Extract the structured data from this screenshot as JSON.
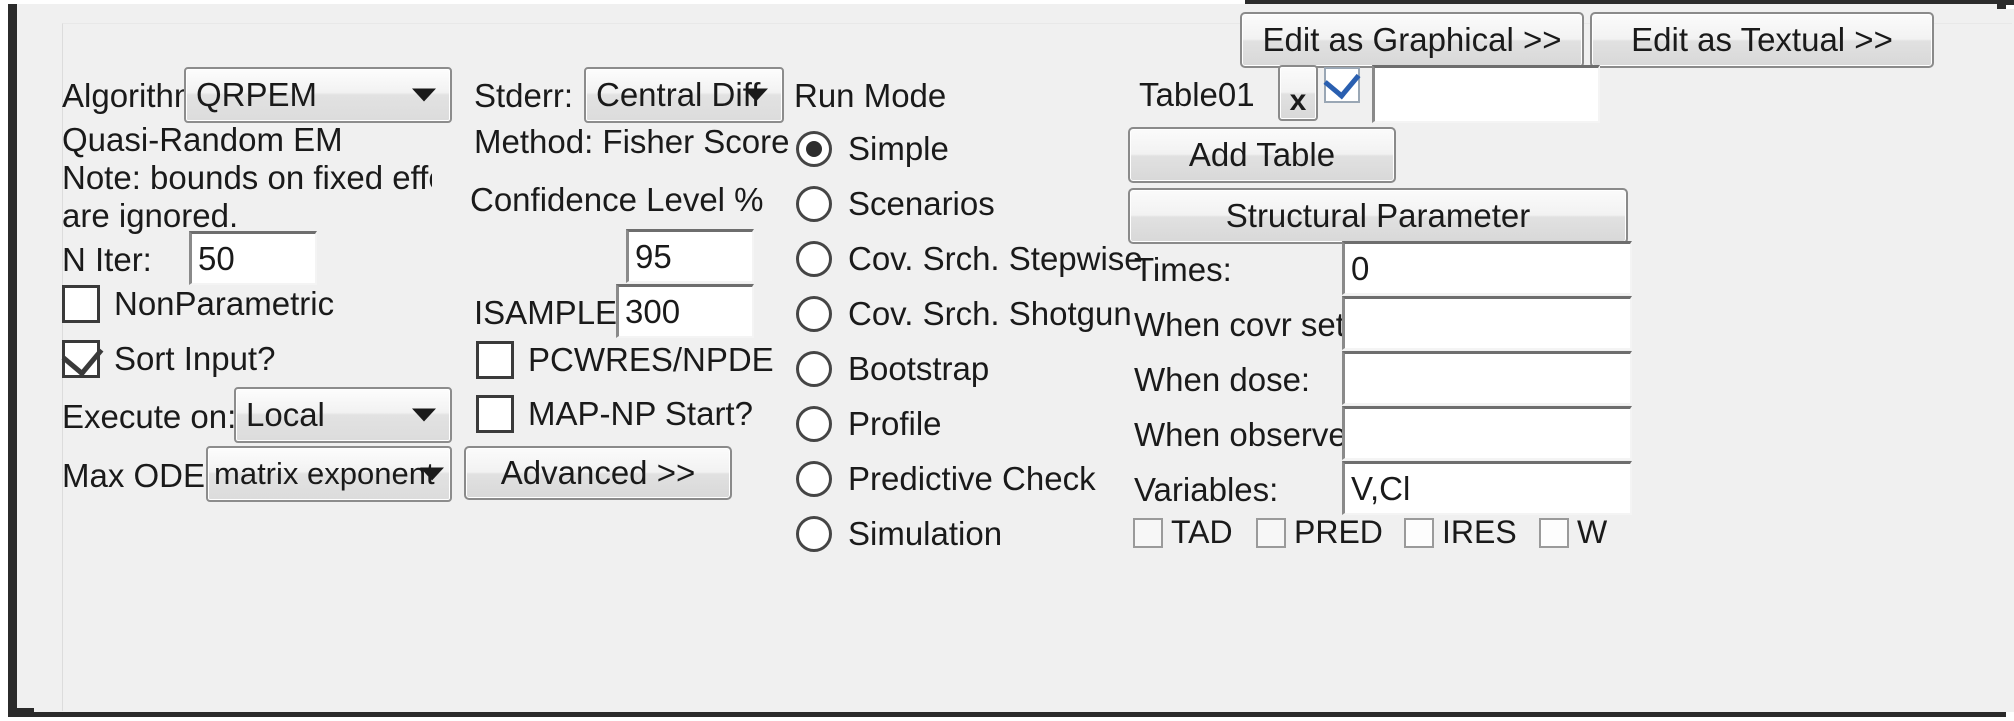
{
  "window": {
    "edit_graphical_button": "Edit as Graphical >>",
    "edit_textual_button": "Edit as Textual >>"
  },
  "algorithm_column": {
    "algorithm_label": "Algorithm:",
    "algorithm_value": "QRPEM",
    "algorithm_desc_line1": "Quasi-Random EM",
    "algorithm_desc_line2": "Note: bounds on fixed effects",
    "algorithm_desc_line3": "are ignored.",
    "niter_label": "N Iter:",
    "niter_value": "50",
    "nonparametric_label": "NonParametric",
    "nonparametric_checked": false,
    "sort_input_label": "Sort Input?",
    "sort_input_checked": true,
    "execute_on_label": "Execute on:",
    "execute_on_value": "Local",
    "max_ode_label": "Max ODE:",
    "max_ode_value": "matrix exponent"
  },
  "stderr_column": {
    "stderr_label": "Stderr:",
    "stderr_value": "Central Diff",
    "method_label": "Method:  Fisher Score",
    "confidence_label": "Confidence Level %",
    "confidence_value": "95",
    "isample_label": "ISAMPLE:",
    "isample_value": "300",
    "pcwres_label": "PCWRES/NPDE",
    "pcwres_checked": false,
    "mapnp_label": "MAP-NP Start?",
    "mapnp_checked": false,
    "advanced_button": "Advanced >>"
  },
  "run_mode": {
    "title": "Run Mode",
    "selected": "Simple",
    "options": [
      {
        "label": "Simple",
        "selected": true
      },
      {
        "label": "Scenarios",
        "selected": false
      },
      {
        "label": "Cov. Srch. Stepwise",
        "selected": false
      },
      {
        "label": "Cov. Srch. Shotgun",
        "selected": false
      },
      {
        "label": "Bootstrap",
        "selected": false
      },
      {
        "label": "Profile",
        "selected": false
      },
      {
        "label": "Predictive Check",
        "selected": false
      },
      {
        "label": "Simulation",
        "selected": false
      }
    ]
  },
  "table_panel": {
    "table_name": "Table01",
    "remove_button": "x",
    "table_enabled": true,
    "table_filename_value": "",
    "add_table_button": "Add Table",
    "structural_parameter_button": "Structural Parameter",
    "times_label": "Times:",
    "times_value": "0",
    "when_covr_set_label": "When covr set:",
    "when_covr_set_value": "",
    "when_dose_label": "When dose:",
    "when_dose_value": "",
    "when_observe_label": "When observe:",
    "when_observe_value": "",
    "variables_label": "Variables:",
    "variables_value": "V,Cl",
    "output_flags": [
      {
        "label": "TAD",
        "checked": false
      },
      {
        "label": "PRED",
        "checked": false
      },
      {
        "label": "IRES",
        "checked": false
      },
      {
        "label": "W",
        "checked": false
      }
    ]
  },
  "colors": {
    "panel_bg": "#f0f0f0",
    "frame": "#2b2b2b",
    "text": "#1a1a1a",
    "field_bg": "#ffffff",
    "check_accent": "#2a5fb0"
  }
}
